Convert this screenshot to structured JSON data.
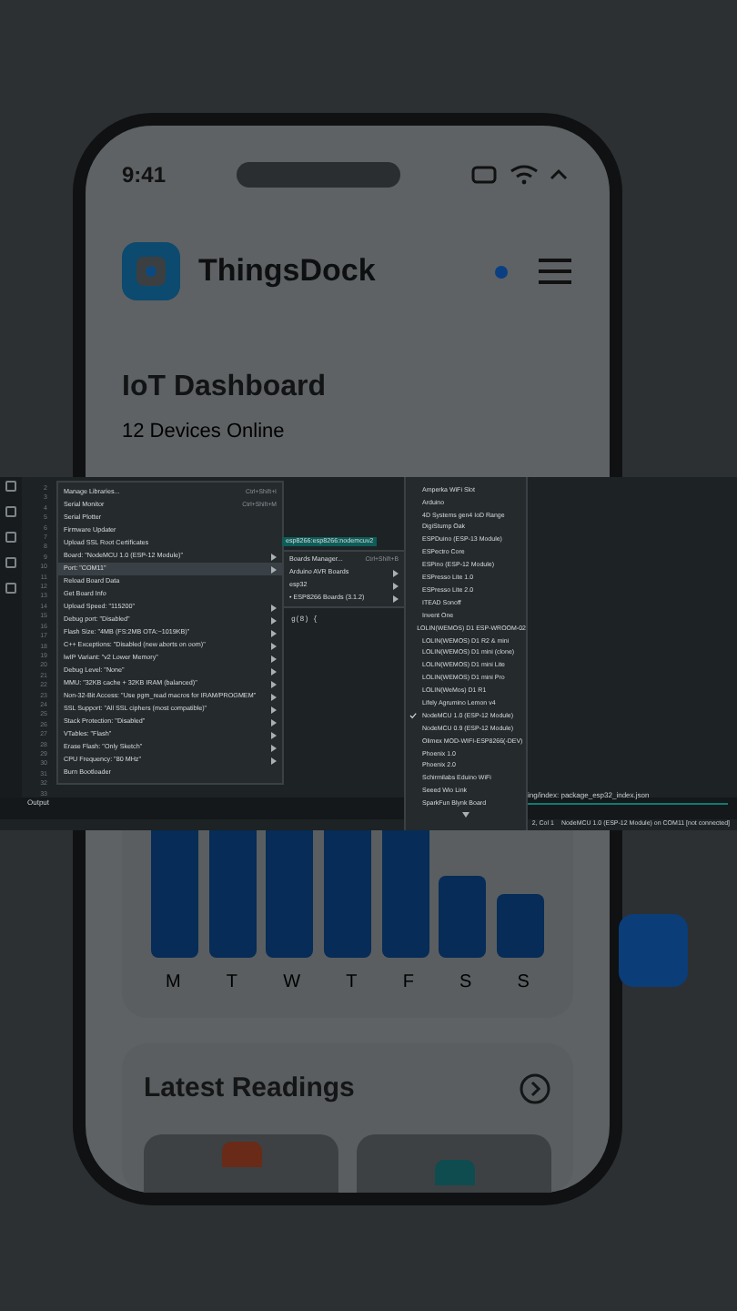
{
  "phone": {
    "status_time": "9:41",
    "app_name": "ThingsDock",
    "title": "IoT Dashboard",
    "subtitle": "12 Devices Online",
    "days": [
      "M",
      "T",
      "W",
      "T",
      "F",
      "S",
      "S"
    ],
    "readings_title": "Latest Readings"
  },
  "ide": {
    "line_numbers": [
      "2",
      "3",
      "4",
      "5",
      "6",
      "7",
      "8",
      "9",
      "10",
      "11",
      "12",
      "13",
      "14",
      "15",
      "16",
      "17",
      "18",
      "19",
      "20",
      "21",
      "22",
      "23",
      "24",
      "25",
      "26",
      "27",
      "28",
      "29",
      "30",
      "31",
      "32",
      "33"
    ],
    "code_fragment": "g(8) {",
    "menu": [
      {
        "label": "Manage Libraries...",
        "shortcut": "Ctrl+Shift+I",
        "submenu": false,
        "selected": false
      },
      {
        "label": "Serial Monitor",
        "shortcut": "Ctrl+Shift+M",
        "submenu": false,
        "selected": false
      },
      {
        "label": "Serial Plotter",
        "submenu": false,
        "selected": false
      },
      {
        "label": "Firmware Updater",
        "submenu": false,
        "selected": false
      },
      {
        "label": "Upload SSL Root Certificates",
        "submenu": false,
        "selected": false
      },
      {
        "label": "Board: \"NodeMCU 1.0 (ESP-12 Module)\"",
        "submenu": true,
        "selected": false
      },
      {
        "label": "Port: \"COM11\"",
        "submenu": true,
        "selected": true
      },
      {
        "label": "Reload Board Data",
        "submenu": false,
        "selected": false
      },
      {
        "label": "Get Board Info",
        "submenu": false,
        "selected": false
      },
      {
        "label": "Upload Speed: \"115200\"",
        "submenu": true,
        "selected": false
      },
      {
        "label": "Debug port: \"Disabled\"",
        "submenu": true,
        "selected": false
      },
      {
        "label": "Flash Size: \"4MB (FS:2MB OTA:~1019KB)\"",
        "submenu": true,
        "selected": false
      },
      {
        "label": "C++ Exceptions: \"Disabled (new aborts on oom)\"",
        "submenu": true,
        "selected": false
      },
      {
        "label": "lwIP Variant: \"v2 Lower Memory\"",
        "submenu": true,
        "selected": false
      },
      {
        "label": "Debug Level: \"None\"",
        "submenu": true,
        "selected": false
      },
      {
        "label": "MMU: \"32KB cache + 32KB IRAM (balanced)\"",
        "submenu": true,
        "selected": false
      },
      {
        "label": "Non-32-Bit Access: \"Use pgm_read macros for IRAM/PROGMEM\"",
        "submenu": true,
        "selected": false
      },
      {
        "label": "SSL Support: \"All SSL ciphers (most compatible)\"",
        "submenu": true,
        "selected": false
      },
      {
        "label": "Stack Protection: \"Disabled\"",
        "submenu": true,
        "selected": false
      },
      {
        "label": "VTables: \"Flash\"",
        "submenu": true,
        "selected": false
      },
      {
        "label": "Erase Flash: \"Only Sketch\"",
        "submenu": true,
        "selected": false
      },
      {
        "label": "CPU Frequency: \"80 MHz\"",
        "submenu": true,
        "selected": false
      },
      {
        "label": "Burn Bootloader",
        "submenu": false,
        "selected": false
      }
    ],
    "board_tooltip": "esp8266:esp8266:nodemcuv2",
    "submenu": [
      {
        "label": "Boards Manager...",
        "shortcut": "Ctrl+Shift+B",
        "submenu": false
      },
      {
        "label": "Arduino AVR Boards",
        "submenu": true
      },
      {
        "label": "esp32",
        "submenu": true
      },
      {
        "label": "• ESP8266 Boards (3.1.2)",
        "submenu": true
      }
    ],
    "boards": [
      {
        "label": "Amperka WiFi Slot",
        "checked": false
      },
      {
        "label": "Arduino",
        "checked": false
      },
      {
        "label": "4D Systems gen4 IoD Range",
        "checked": false
      },
      {
        "label": "DigiStump Oak",
        "checked": false
      },
      {
        "label": "ESPDuino (ESP-13 Module)",
        "checked": false
      },
      {
        "label": "ESPectro Core",
        "checked": false
      },
      {
        "label": "ESPino (ESP-12 Module)",
        "checked": false
      },
      {
        "label": "ESPresso Lite 1.0",
        "checked": false
      },
      {
        "label": "ESPresso Lite 2.0",
        "checked": false
      },
      {
        "label": "ITEAD Sonoff",
        "checked": false
      },
      {
        "label": "Invent One",
        "checked": false
      },
      {
        "label": "LOLIN(WEMOS) D1 ESP-WROOM-02",
        "checked": false
      },
      {
        "label": "LOLIN(WEMOS) D1 R2 & mini",
        "checked": false
      },
      {
        "label": "LOLIN(WEMOS) D1 mini (clone)",
        "checked": false
      },
      {
        "label": "LOLIN(WEMOS) D1 mini Lite",
        "checked": false
      },
      {
        "label": "LOLIN(WEMOS) D1 mini Pro",
        "checked": false
      },
      {
        "label": "LOLIN(WeMos) D1 R1",
        "checked": false
      },
      {
        "label": "Lifely Agrumino Lemon v4",
        "checked": false
      },
      {
        "label": "NodeMCU 1.0 (ESP-12 Module)",
        "checked": true
      },
      {
        "label": "NodeMCU 0.9 (ESP-12 Module)",
        "checked": false
      },
      {
        "label": "Olimex MOD-WIFI-ESP8266(-DEV)",
        "checked": false
      },
      {
        "label": "Phoenix 1.0",
        "checked": false
      },
      {
        "label": "Phoenix 2.0",
        "checked": false
      },
      {
        "label": "Schirmilabs Eduino WiFi",
        "checked": false
      },
      {
        "label": "Seeed Wio Link",
        "checked": false
      },
      {
        "label": "SparkFun Blynk Board",
        "checked": false
      }
    ],
    "notification": "ing/index: package_esp32_index.json",
    "output_label": "Output",
    "status_position": "2, Col 1",
    "status_board": "NodeMCU 1.0 (ESP-12 Module) on COM11 [not connected]"
  }
}
